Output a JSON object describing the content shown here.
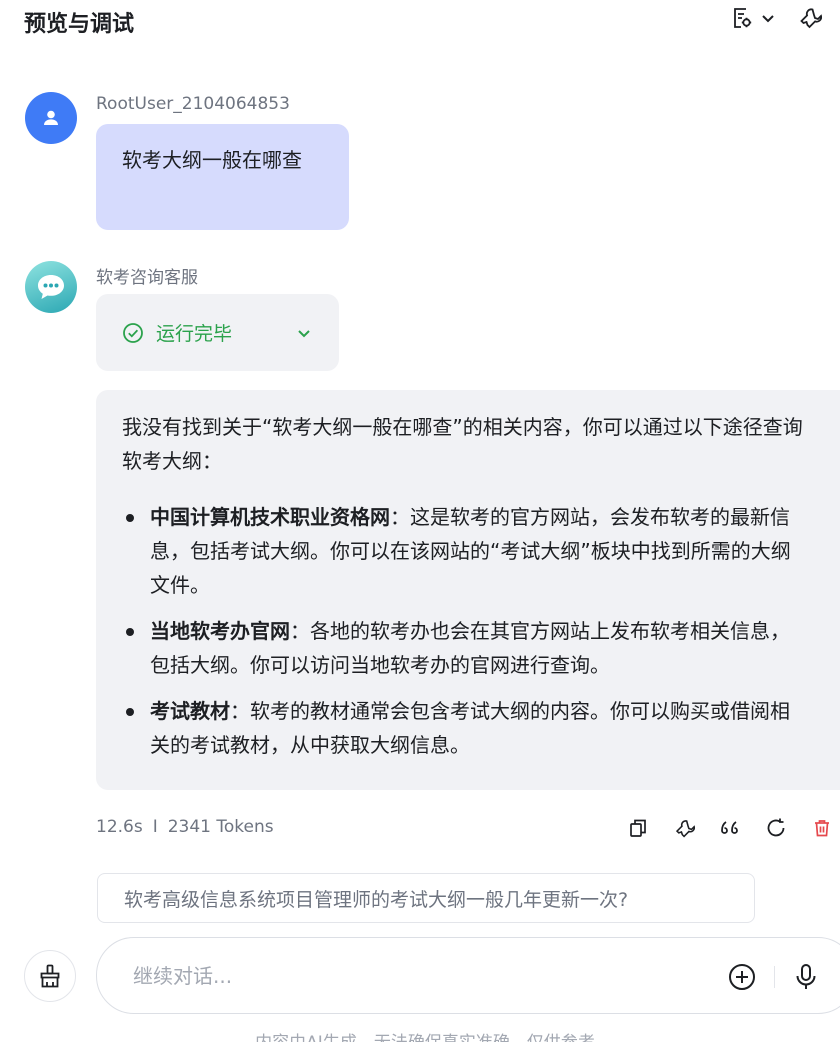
{
  "header": {
    "title": "预览与调试"
  },
  "messages": {
    "user": {
      "name": "RootUser_2104064853",
      "text": "软考大纲一般在哪查"
    },
    "bot": {
      "name": "软考咨询客服",
      "status": "运行完毕",
      "intro": "我没有找到关于“软考大纲一般在哪查”的相关内容，你可以通过以下途径查询软考大纲：",
      "items": [
        {
          "title": "中国计算机技术职业资格网",
          "text": "：这是软考的官方网站，会发布软考的最新信息，包括考试大纲。你可以在该网站的“考试大纲”板块中找到所需的大纲文件。"
        },
        {
          "title": "当地软考办官网",
          "text": "：各地的软考办也会在其官方网站上发布软考相关信息，包括大纲。你可以访问当地软考办的官网进行查询。"
        },
        {
          "title": "考试教材",
          "text": "：软考的教材通常会包含考试大纲的内容。你可以购买或借阅相关的考试教材，从中获取大纲信息。"
        }
      ],
      "time": "12.6s",
      "separator": "I",
      "tokens": "2341 Tokens"
    }
  },
  "suggestion": "软考高级信息系统项目管理师的考试大纲一般几年更新一次?",
  "input": {
    "placeholder": "继续对话..."
  },
  "footer": "内容由AI生成，无法确保真实准确，仅供参考",
  "colors": {
    "user_bubble": "#d6dbfd",
    "bot_bubble": "#f1f2f5",
    "status_green": "#2ba24c",
    "delete_red": "#e5484d",
    "avatar_blue": "#3f7bf6"
  }
}
